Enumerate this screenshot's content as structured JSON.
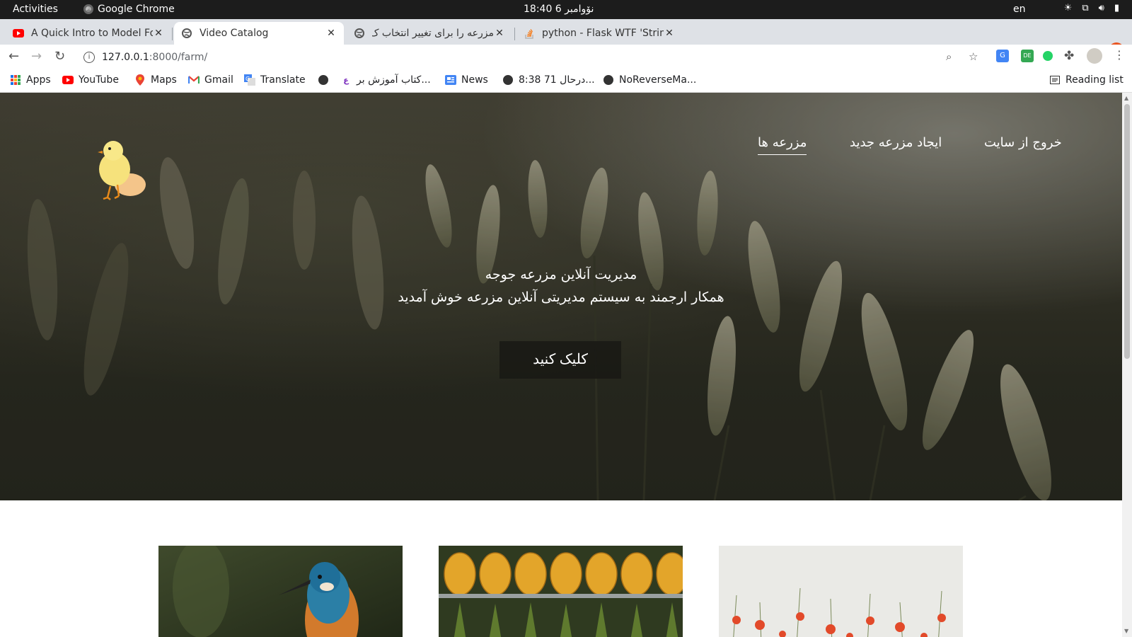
{
  "system_bar": {
    "activities": "Activities",
    "app_name": "Google Chrome",
    "clock": "18:40  6 نۆوامبر",
    "lang": "en"
  },
  "tabs": [
    {
      "title": "A Quick Intro to Model Fo",
      "favicon": "youtube-icon",
      "active": false
    },
    {
      "title": "Video Catalog",
      "favicon": "globe-icon",
      "active": true
    },
    {
      "title": "مزرعه را برای تغییر انتخاب ک",
      "favicon": "globe-icon",
      "active": false
    },
    {
      "title": "python - Flask WTF 'String",
      "favicon": "stackoverflow-icon",
      "active": false
    }
  ],
  "toolbar": {
    "url_host": "127.0.0.1",
    "url_rest": ":8000/farm/"
  },
  "bookmarks": [
    {
      "label": "Apps",
      "icon": "apps-grid-icon"
    },
    {
      "label": "YouTube",
      "icon": "youtube-icon"
    },
    {
      "label": "Maps",
      "icon": "maps-pin-icon"
    },
    {
      "label": "Gmail",
      "icon": "gmail-icon"
    },
    {
      "label": "Translate",
      "icon": "translate-icon"
    },
    {
      "label": "",
      "icon": "globe-icon"
    },
    {
      "label": "کتاب آموزش بر...",
      "icon": "bookmark-icon"
    },
    {
      "label": "News",
      "icon": "news-icon"
    },
    {
      "label": "8:38 71 درحال...",
      "icon": "globe-icon"
    },
    {
      "label": "NoReverseMa...",
      "icon": "globe-icon"
    }
  ],
  "reading_list": "Reading list",
  "page": {
    "nav": {
      "logout": "خروج از سایت",
      "new_farm": "ایجاد مزرعه جدید",
      "farms": "مزرعه ها"
    },
    "hero": {
      "title": "مدیریت آنلاین مزرعه جوجه",
      "subtitle": "همکار ارجمند به سیستم مدیریتی آنلاین مزرعه خوش آمدید",
      "button": "کلیک کنید"
    },
    "cards": [
      {
        "image": "kingfisher-photo"
      },
      {
        "image": "pineapples-photo"
      },
      {
        "image": "poppy-field-photo"
      }
    ]
  },
  "colors": {
    "topbar": "#1c1c1c",
    "tabstrip": "#dee1e6",
    "close_button": "#e95420",
    "hero_button": "#19191a"
  }
}
